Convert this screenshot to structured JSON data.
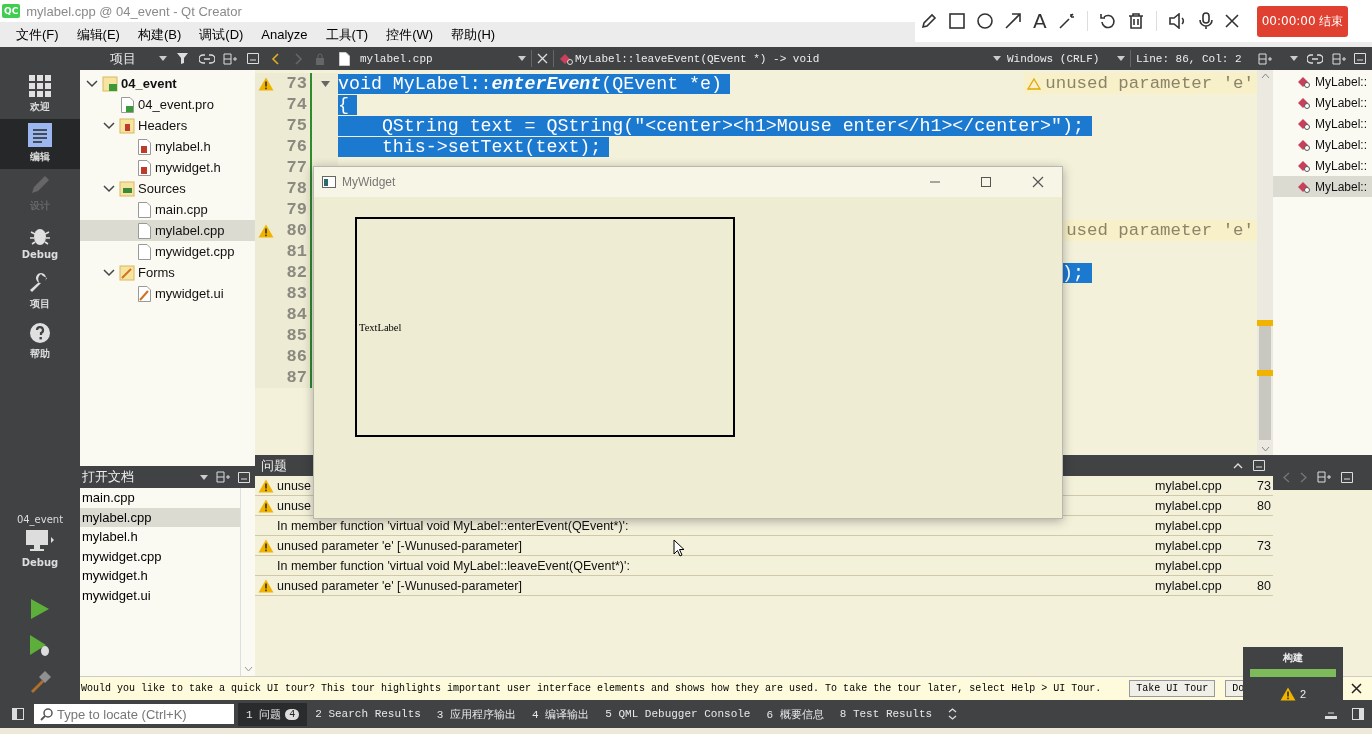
{
  "window": {
    "title": "mylabel.cpp @ 04_event - Qt Creator",
    "logo": "QC"
  },
  "recorder": {
    "text_tool": "A",
    "stop_button": "00:00:00 结束"
  },
  "menu": [
    "文件(F)",
    "编辑(E)",
    "构建(B)",
    "调试(D)",
    "Analyze",
    "工具(T)",
    "控件(W)",
    "帮助(H)"
  ],
  "toolbar": {
    "project_selector": "项目",
    "file_selector": "mylabel.cpp",
    "symbol_selector": "MyLabel::leaveEvent(QEvent *) -> void",
    "line_ending": "Windows (CRLF)",
    "cursor_position": "Line: 86, Col: 2"
  },
  "modes": [
    {
      "kind": "welcome",
      "label": "欢迎",
      "selected": false,
      "disabled": false
    },
    {
      "kind": "edit",
      "label": "编辑",
      "selected": true,
      "disabled": false
    },
    {
      "kind": "design",
      "label": "设计",
      "selected": false,
      "disabled": true
    },
    {
      "kind": "debug",
      "label": "Debug",
      "selected": false,
      "disabled": false
    },
    {
      "kind": "projects",
      "label": "项目",
      "selected": false,
      "disabled": false
    },
    {
      "kind": "help",
      "label": "帮助",
      "selected": false,
      "disabled": false
    }
  ],
  "kit": {
    "project": "04_event",
    "config": "Debug"
  },
  "project_tree": [
    {
      "label": "04_event",
      "kind": "project",
      "expanded": true,
      "selected": false,
      "children": [
        {
          "label": "04_event.pro",
          "kind": "pro",
          "selected": false
        },
        {
          "label": "Headers",
          "kind": "headers",
          "expanded": true,
          "selected": false,
          "children": [
            {
              "label": "mylabel.h",
              "kind": "header",
              "selected": false
            },
            {
              "label": "mywidget.h",
              "kind": "header",
              "selected": false
            }
          ]
        },
        {
          "label": "Sources",
          "kind": "sources",
          "expanded": true,
          "selected": false,
          "children": [
            {
              "label": "main.cpp",
              "kind": "source",
              "selected": false
            },
            {
              "label": "mylabel.cpp",
              "kind": "source",
              "selected": true
            },
            {
              "label": "mywidget.cpp",
              "kind": "source",
              "selected": false
            }
          ]
        },
        {
          "label": "Forms",
          "kind": "forms",
          "expanded": true,
          "selected": false,
          "children": [
            {
              "label": "mywidget.ui",
              "kind": "form",
              "selected": false
            }
          ]
        }
      ]
    }
  ],
  "editor": {
    "lines": [
      {
        "number": "73",
        "kind": "code",
        "warning": true,
        "fold": true,
        "selected": true,
        "code": "void MyLabel::**enterEvent**(QEvent *e)",
        "annotation": "unused parameter 'e'",
        "annotation_warning": true
      },
      {
        "number": "74",
        "kind": "code",
        "warning": false,
        "fold": false,
        "selected": true,
        "code": "{"
      },
      {
        "number": "75",
        "kind": "code",
        "warning": false,
        "fold": false,
        "selected": true,
        "code": "    QString text = QString(\"<center><h1>Mouse enter</h1></center>\");"
      },
      {
        "number": "76",
        "kind": "code",
        "warning": false,
        "fold": false,
        "selected": true,
        "code": "    this->setText(text);"
      },
      {
        "number": "77",
        "kind": "code",
        "warning": false,
        "fold": false
      },
      {
        "number": "78",
        "kind": "code",
        "warning": false,
        "fold": false
      },
      {
        "number": "79",
        "kind": "code",
        "warning": false,
        "fold": false
      },
      {
        "number": "80",
        "kind": "code",
        "warning": true,
        "fold": false,
        "annotation": "used parameter 'e'",
        "annotation_warning": false
      },
      {
        "number": "81",
        "kind": "code",
        "warning": false,
        "fold": false
      },
      {
        "number": "82",
        "kind": "tail",
        "warning": false,
        "fold": false,
        "selected": true,
        "code": ");"
      },
      {
        "number": "83",
        "kind": "code",
        "warning": false,
        "fold": false
      },
      {
        "number": "84",
        "kind": "code",
        "warning": false,
        "fold": false
      },
      {
        "number": "85",
        "kind": "code",
        "warning": false,
        "fold": false
      },
      {
        "number": "86",
        "kind": "code",
        "warning": false,
        "fold": false
      },
      {
        "number": "87",
        "kind": "code",
        "warning": false,
        "fold": false
      }
    ]
  },
  "outline": [
    {
      "label": "MyLabel::",
      "selected": false
    },
    {
      "label": "MyLabel::",
      "selected": false
    },
    {
      "label": "MyLabel::",
      "selected": false
    },
    {
      "label": "MyLabel::",
      "selected": false
    },
    {
      "label": "MyLabel::",
      "selected": false
    },
    {
      "label": "MyLabel::",
      "selected": true
    }
  ],
  "open_documents": {
    "title": "打开文档",
    "items": [
      {
        "label": "main.cpp",
        "selected": false
      },
      {
        "label": "mylabel.cpp",
        "selected": true
      },
      {
        "label": "mylabel.h",
        "selected": false
      },
      {
        "label": "mywidget.cpp",
        "selected": false
      },
      {
        "label": "mywidget.h",
        "selected": false
      },
      {
        "label": "mywidget.ui",
        "selected": false
      }
    ]
  },
  "issues": {
    "title": "问题",
    "rows": [
      {
        "kind": "warning",
        "text": "unuse",
        "file": "mylabel.cpp",
        "line": "73"
      },
      {
        "kind": "warning",
        "text": "unuse",
        "file": "mylabel.cpp",
        "line": "80"
      },
      {
        "kind": "info",
        "text": "In member function 'virtual void MyLabel::enterEvent(QEvent*)':",
        "file": "mylabel.cpp"
      },
      {
        "kind": "warning",
        "text": "unused parameter 'e' [-Wunused-parameter]",
        "file": "mylabel.cpp",
        "line": "73"
      },
      {
        "kind": "info",
        "text": "In member function 'virtual void MyLabel::leaveEvent(QEvent*)':",
        "file": "mylabel.cpp"
      },
      {
        "kind": "warning",
        "text": "unused parameter 'e' [-Wunused-parameter]",
        "file": "mylabel.cpp",
        "line": "80"
      }
    ]
  },
  "app_window": {
    "title": "MyWidget",
    "label_text": "TextLabel"
  },
  "tour": {
    "message": "Would you like to take a quick UI tour? This tour highlights important user interface elements and shows how they are used. To take the tour later, select Help > UI Tour.",
    "buttons": [
      "Take UI Tour",
      "Do"
    ]
  },
  "status_bar": {
    "locate_placeholder": "Type to locate (Ctrl+K)",
    "tabs": [
      {
        "number": "1",
        "label": "问题",
        "badge": "4",
        "selected": true
      },
      {
        "number": "2",
        "label": "Search Results",
        "selected": false
      },
      {
        "number": "3",
        "label": "应用程序输出",
        "selected": false
      },
      {
        "number": "4",
        "label": "编译输出",
        "selected": false
      },
      {
        "number": "5",
        "label": "QML Debugger Console",
        "selected": false
      },
      {
        "number": "6",
        "label": "概要信息",
        "selected": false
      },
      {
        "number": "8",
        "label": "Test Results",
        "selected": false
      }
    ]
  },
  "build": {
    "title": "构建",
    "level": 1,
    "warnings": "2"
  }
}
